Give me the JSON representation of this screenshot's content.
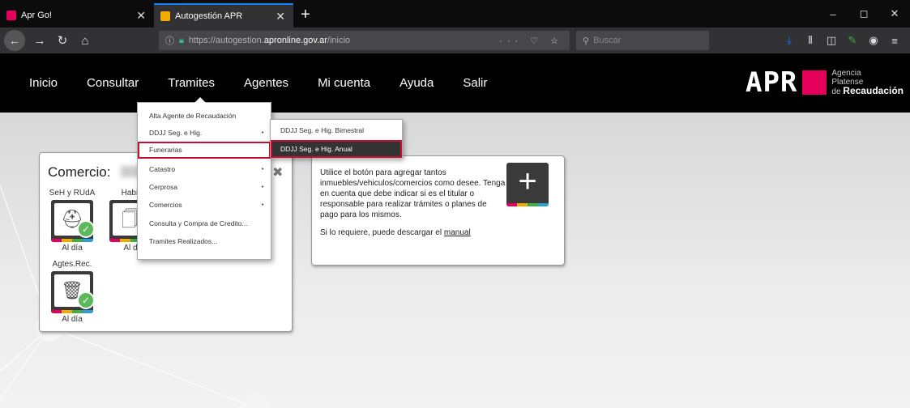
{
  "browser": {
    "tabs": [
      {
        "title": "Apr Go!",
        "favicon_color": "#e4005b"
      },
      {
        "title": "Autogestión APR",
        "favicon_color": "#f2a900"
      }
    ],
    "new_tab": "+",
    "window_controls": [
      "–",
      "◻",
      "✕"
    ],
    "url": {
      "prefix": "https://autogestion.",
      "host": "apronline.gov.ar",
      "path": "/inicio"
    },
    "url_actions": "··· ♡ ☆",
    "search_placeholder": "Buscar",
    "nav_icons": {
      "back": "←",
      "forward": "→",
      "reload": "↻",
      "home": "⌂"
    },
    "toolbar_icons": {
      "download": "⤓",
      "library": "⫴",
      "sidebar": "◫",
      "extension": "✎",
      "account": "◉",
      "menu": "≡"
    }
  },
  "site": {
    "menu": [
      "Inicio",
      "Consultar",
      "Tramites",
      "Agentes",
      "Mi cuenta",
      "Ayuda",
      "Salir"
    ],
    "logo": {
      "mark": "APR",
      "line1": "Agencia",
      "line2": "Platense",
      "line3_prefix": "de ",
      "line3_bold": "Recaudación",
      "accent": "#e4005b"
    }
  },
  "dropdown": {
    "items": [
      {
        "label": "Alta Agente de Recaudación",
        "arrow": ""
      },
      {
        "label": "DDJJ Seg. e Hig.",
        "arrow": "▸"
      },
      {
        "label": "Funerarias",
        "arrow": ""
      },
      {
        "label": "Catastro",
        "arrow": "▸"
      },
      {
        "label": "Cerprosa",
        "arrow": "▸"
      },
      {
        "label": "Comercios",
        "arrow": "▸"
      },
      {
        "label": "Consulta y Compra de Credito...",
        "arrow": ""
      },
      {
        "label": "Tramites Realizados...",
        "arrow": ""
      }
    ],
    "submenu": [
      "DDJJ Seg. e Hig. Bimestral",
      "DDJJ Seg. e Hig. Anual"
    ]
  },
  "comercio_card": {
    "title": "Comercio:",
    "close": "✖",
    "services": [
      {
        "label": "SeH y RUdA",
        "status": "Al día",
        "icon": "helmet-icon"
      },
      {
        "label": "Habil",
        "status": "Al d",
        "icon": "documents-icon"
      },
      {
        "label": "Agtes.Rec.",
        "status": "Al día",
        "icon": "trash-icon"
      }
    ],
    "stripe_colors": [
      "#e4005b",
      "#f2a900",
      "#3fae49",
      "#2b9fd9"
    ]
  },
  "info_card": {
    "paragraph1": "Utilice el botón para agregar tantos inmuebles/vehiculos/comercios como desee. Tenga en cuenta que debe indicar si es el titular o responsable para realizar trámites o planes de pago para los mismos.",
    "paragraph2_prefix": "Si lo requiere, puede descargar el ",
    "link": "manual",
    "add_symbol": "+"
  }
}
